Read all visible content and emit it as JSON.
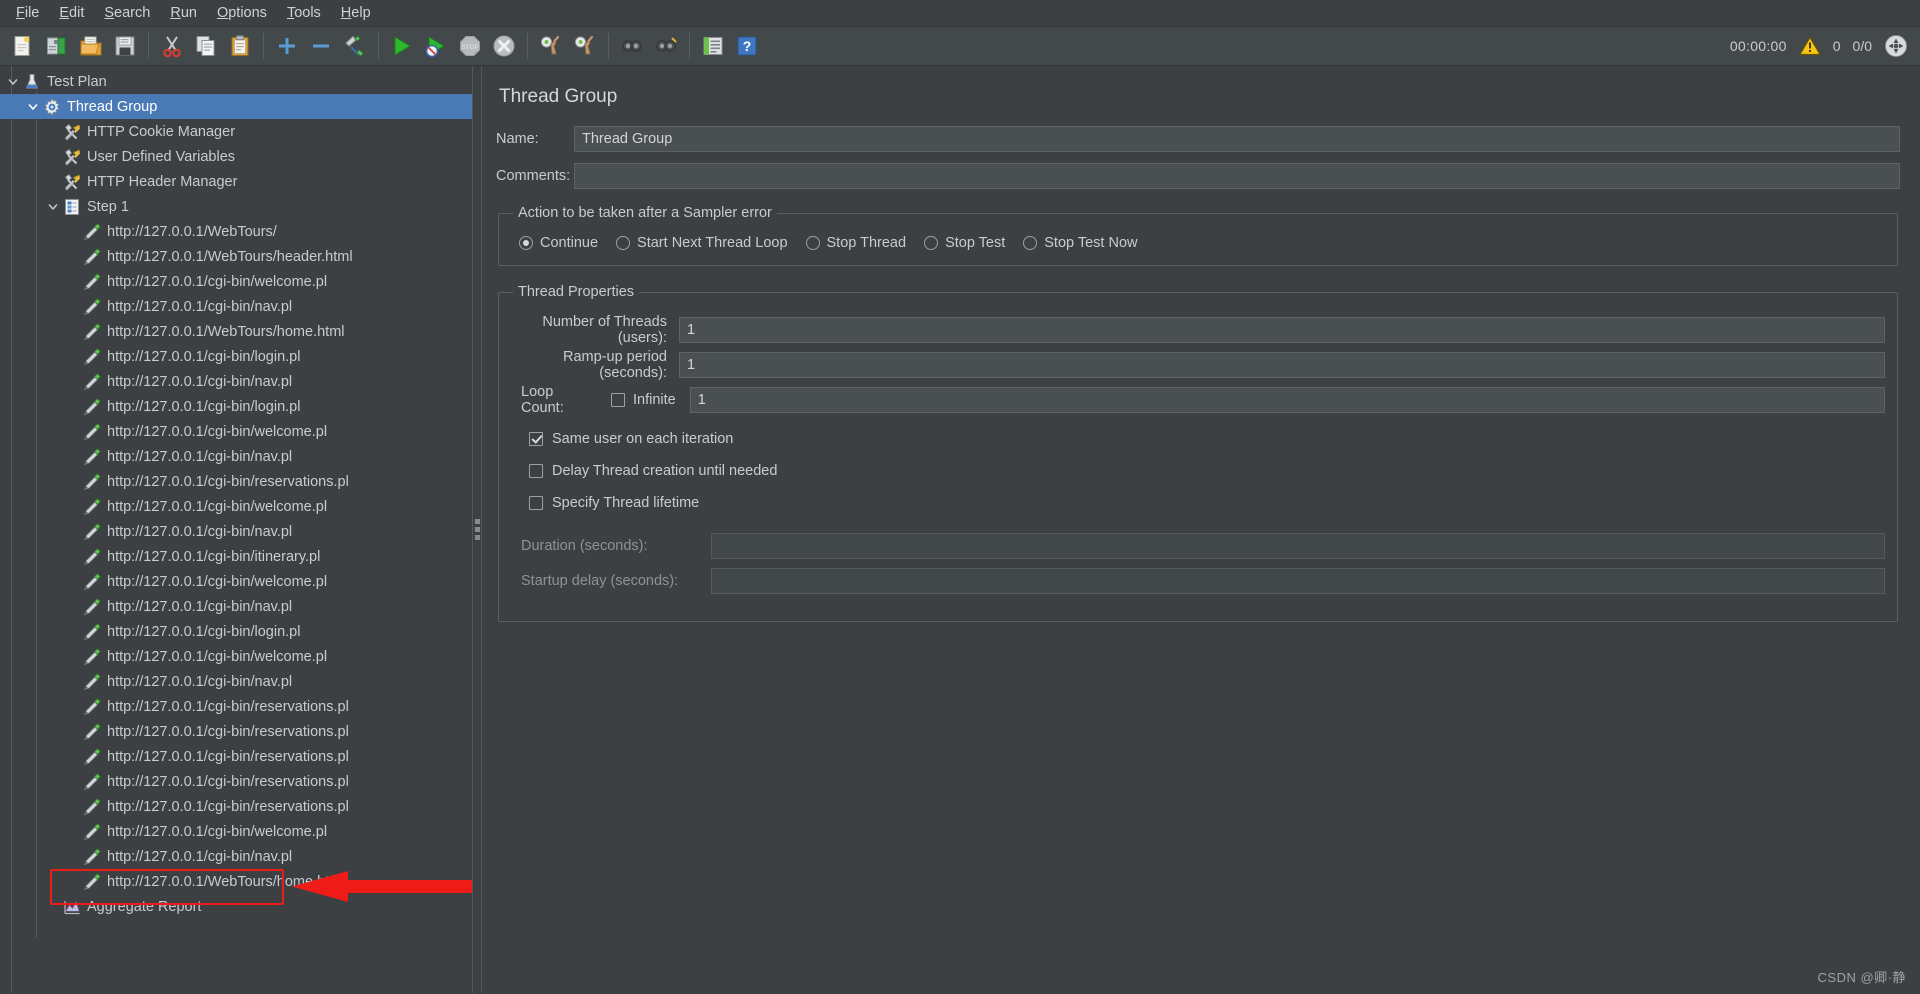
{
  "menubar": {
    "items": [
      {
        "label": "File",
        "mnemonic": "F"
      },
      {
        "label": "Edit",
        "mnemonic": "E"
      },
      {
        "label": "Search",
        "mnemonic": "S"
      },
      {
        "label": "Run",
        "mnemonic": "R"
      },
      {
        "label": "Options",
        "mnemonic": "O"
      },
      {
        "label": "Tools",
        "mnemonic": "T"
      },
      {
        "label": "Help",
        "mnemonic": "H"
      }
    ]
  },
  "toolbar": {
    "buttons": [
      {
        "name": "new-icon",
        "title": "New"
      },
      {
        "name": "templates-icon",
        "title": "Templates"
      },
      {
        "name": "open-icon",
        "title": "Open"
      },
      {
        "name": "save-icon",
        "title": "Save Test Plan"
      },
      {
        "name": "separator-1",
        "title": ""
      },
      {
        "name": "cut-icon",
        "title": "Cut"
      },
      {
        "name": "copy-icon",
        "title": "Copy"
      },
      {
        "name": "paste-icon",
        "title": "Paste"
      },
      {
        "name": "separator-2",
        "title": ""
      },
      {
        "name": "expand-all-icon",
        "title": "Expand All"
      },
      {
        "name": "collapse-all-icon",
        "title": "Collapse All"
      },
      {
        "name": "toggle-icon",
        "title": "Toggle"
      },
      {
        "name": "separator-3",
        "title": ""
      },
      {
        "name": "start-icon",
        "title": "Start"
      },
      {
        "name": "start-no-pauses-icon",
        "title": "Start no pauses"
      },
      {
        "name": "stop-icon",
        "title": "Stop"
      },
      {
        "name": "shutdown-icon",
        "title": "Shutdown"
      },
      {
        "name": "separator-4",
        "title": ""
      },
      {
        "name": "remote-start-all-icon",
        "title": "Remote Start All"
      },
      {
        "name": "remote-stop-all-icon",
        "title": "Remote Stop All"
      },
      {
        "name": "separator-5",
        "title": ""
      },
      {
        "name": "clear-icon",
        "title": "Clear"
      },
      {
        "name": "clear-all-icon",
        "title": "Clear All"
      },
      {
        "name": "separator-6",
        "title": ""
      },
      {
        "name": "function-helper-icon",
        "title": "Function Helper Dialog"
      },
      {
        "name": "help-icon",
        "title": "Help"
      }
    ],
    "status": {
      "elapsed": "00:00:00",
      "warning_count": "0",
      "threads": "0/0"
    }
  },
  "tree": {
    "nodes": [
      {
        "label": "Test Plan",
        "icon": "test-plan-icon",
        "depth": 0,
        "twisty": "expanded",
        "selected": false
      },
      {
        "label": "Thread Group",
        "icon": "thread-group-icon",
        "depth": 1,
        "twisty": "expanded",
        "selected": true
      },
      {
        "label": "HTTP Cookie Manager",
        "icon": "config-element-icon",
        "depth": 2,
        "twisty": "none",
        "selected": false
      },
      {
        "label": "User Defined Variables",
        "icon": "config-element-icon",
        "depth": 2,
        "twisty": "none",
        "selected": false
      },
      {
        "label": "HTTP Header Manager",
        "icon": "config-element-icon",
        "depth": 2,
        "twisty": "none",
        "selected": false
      },
      {
        "label": "Step 1",
        "icon": "transaction-controller-icon",
        "depth": 2,
        "twisty": "expanded",
        "selected": false
      },
      {
        "label": "http://127.0.0.1/WebTours/",
        "icon": "http-sampler-icon",
        "depth": 3,
        "twisty": "none",
        "selected": false
      },
      {
        "label": "http://127.0.0.1/WebTours/header.html",
        "icon": "http-sampler-icon",
        "depth": 3,
        "twisty": "none",
        "selected": false
      },
      {
        "label": "http://127.0.0.1/cgi-bin/welcome.pl",
        "icon": "http-sampler-icon",
        "depth": 3,
        "twisty": "none",
        "selected": false
      },
      {
        "label": "http://127.0.0.1/cgi-bin/nav.pl",
        "icon": "http-sampler-icon",
        "depth": 3,
        "twisty": "none",
        "selected": false
      },
      {
        "label": "http://127.0.0.1/WebTours/home.html",
        "icon": "http-sampler-icon",
        "depth": 3,
        "twisty": "none",
        "selected": false
      },
      {
        "label": "http://127.0.0.1/cgi-bin/login.pl",
        "icon": "http-sampler-icon",
        "depth": 3,
        "twisty": "none",
        "selected": false
      },
      {
        "label": "http://127.0.0.1/cgi-bin/nav.pl",
        "icon": "http-sampler-icon",
        "depth": 3,
        "twisty": "none",
        "selected": false
      },
      {
        "label": "http://127.0.0.1/cgi-bin/login.pl",
        "icon": "http-sampler-icon",
        "depth": 3,
        "twisty": "none",
        "selected": false
      },
      {
        "label": "http://127.0.0.1/cgi-bin/welcome.pl",
        "icon": "http-sampler-icon",
        "depth": 3,
        "twisty": "none",
        "selected": false
      },
      {
        "label": "http://127.0.0.1/cgi-bin/nav.pl",
        "icon": "http-sampler-icon",
        "depth": 3,
        "twisty": "none",
        "selected": false
      },
      {
        "label": "http://127.0.0.1/cgi-bin/reservations.pl",
        "icon": "http-sampler-icon",
        "depth": 3,
        "twisty": "none",
        "selected": false
      },
      {
        "label": "http://127.0.0.1/cgi-bin/welcome.pl",
        "icon": "http-sampler-icon",
        "depth": 3,
        "twisty": "none",
        "selected": false
      },
      {
        "label": "http://127.0.0.1/cgi-bin/nav.pl",
        "icon": "http-sampler-icon",
        "depth": 3,
        "twisty": "none",
        "selected": false
      },
      {
        "label": "http://127.0.0.1/cgi-bin/itinerary.pl",
        "icon": "http-sampler-icon",
        "depth": 3,
        "twisty": "none",
        "selected": false
      },
      {
        "label": "http://127.0.0.1/cgi-bin/welcome.pl",
        "icon": "http-sampler-icon",
        "depth": 3,
        "twisty": "none",
        "selected": false
      },
      {
        "label": "http://127.0.0.1/cgi-bin/nav.pl",
        "icon": "http-sampler-icon",
        "depth": 3,
        "twisty": "none",
        "selected": false
      },
      {
        "label": "http://127.0.0.1/cgi-bin/login.pl",
        "icon": "http-sampler-icon",
        "depth": 3,
        "twisty": "none",
        "selected": false
      },
      {
        "label": "http://127.0.0.1/cgi-bin/welcome.pl",
        "icon": "http-sampler-icon",
        "depth": 3,
        "twisty": "none",
        "selected": false
      },
      {
        "label": "http://127.0.0.1/cgi-bin/nav.pl",
        "icon": "http-sampler-icon",
        "depth": 3,
        "twisty": "none",
        "selected": false
      },
      {
        "label": "http://127.0.0.1/cgi-bin/reservations.pl",
        "icon": "http-sampler-icon",
        "depth": 3,
        "twisty": "none",
        "selected": false
      },
      {
        "label": "http://127.0.0.1/cgi-bin/reservations.pl",
        "icon": "http-sampler-icon",
        "depth": 3,
        "twisty": "none",
        "selected": false
      },
      {
        "label": "http://127.0.0.1/cgi-bin/reservations.pl",
        "icon": "http-sampler-icon",
        "depth": 3,
        "twisty": "none",
        "selected": false
      },
      {
        "label": "http://127.0.0.1/cgi-bin/reservations.pl",
        "icon": "http-sampler-icon",
        "depth": 3,
        "twisty": "none",
        "selected": false
      },
      {
        "label": "http://127.0.0.1/cgi-bin/reservations.pl",
        "icon": "http-sampler-icon",
        "depth": 3,
        "twisty": "none",
        "selected": false
      },
      {
        "label": "http://127.0.0.1/cgi-bin/welcome.pl",
        "icon": "http-sampler-icon",
        "depth": 3,
        "twisty": "none",
        "selected": false
      },
      {
        "label": "http://127.0.0.1/cgi-bin/nav.pl",
        "icon": "http-sampler-icon",
        "depth": 3,
        "twisty": "none",
        "selected": false
      },
      {
        "label": "http://127.0.0.1/WebTours/home.html",
        "icon": "http-sampler-icon",
        "depth": 3,
        "twisty": "none",
        "selected": false
      },
      {
        "label": "Aggregate Report",
        "icon": "aggregate-report-icon",
        "depth": 2,
        "twisty": "none",
        "selected": false
      }
    ],
    "annotation": {
      "highlight_color": "#ee1b17",
      "arrow_color": "#ee1b17",
      "highlighted_node": "Aggregate Report"
    }
  },
  "panel": {
    "title": "Thread Group",
    "name_label": "Name:",
    "name_value": "Thread Group",
    "comments_label": "Comments:",
    "comments_value": "",
    "comments_placeholder": "",
    "error_action": {
      "legend": "Action to be taken after a Sampler error",
      "options": [
        {
          "label": "Continue",
          "checked": true
        },
        {
          "label": "Start Next Thread Loop",
          "checked": false
        },
        {
          "label": "Stop Thread",
          "checked": false
        },
        {
          "label": "Stop Test",
          "checked": false
        },
        {
          "label": "Stop Test Now",
          "checked": false
        }
      ]
    },
    "thread_properties": {
      "legend": "Thread Properties",
      "num_threads_label": "Number of Threads (users):",
      "num_threads_value": "1",
      "rampup_label": "Ramp-up period (seconds):",
      "rampup_value": "1",
      "loop_count_label": "Loop Count:",
      "infinite_label": "Infinite",
      "infinite_checked": false,
      "loop_count_value": "1",
      "same_user_label": "Same user on each iteration",
      "same_user_checked": true,
      "delay_thread_label": "Delay Thread creation until needed",
      "delay_thread_checked": false,
      "specify_lifetime_label": "Specify Thread lifetime",
      "specify_lifetime_checked": false,
      "duration_label": "Duration (seconds):",
      "duration_value": "",
      "startup_delay_label": "Startup delay (seconds):",
      "startup_delay_value": ""
    }
  },
  "watermark": "CSDN @卿·静"
}
